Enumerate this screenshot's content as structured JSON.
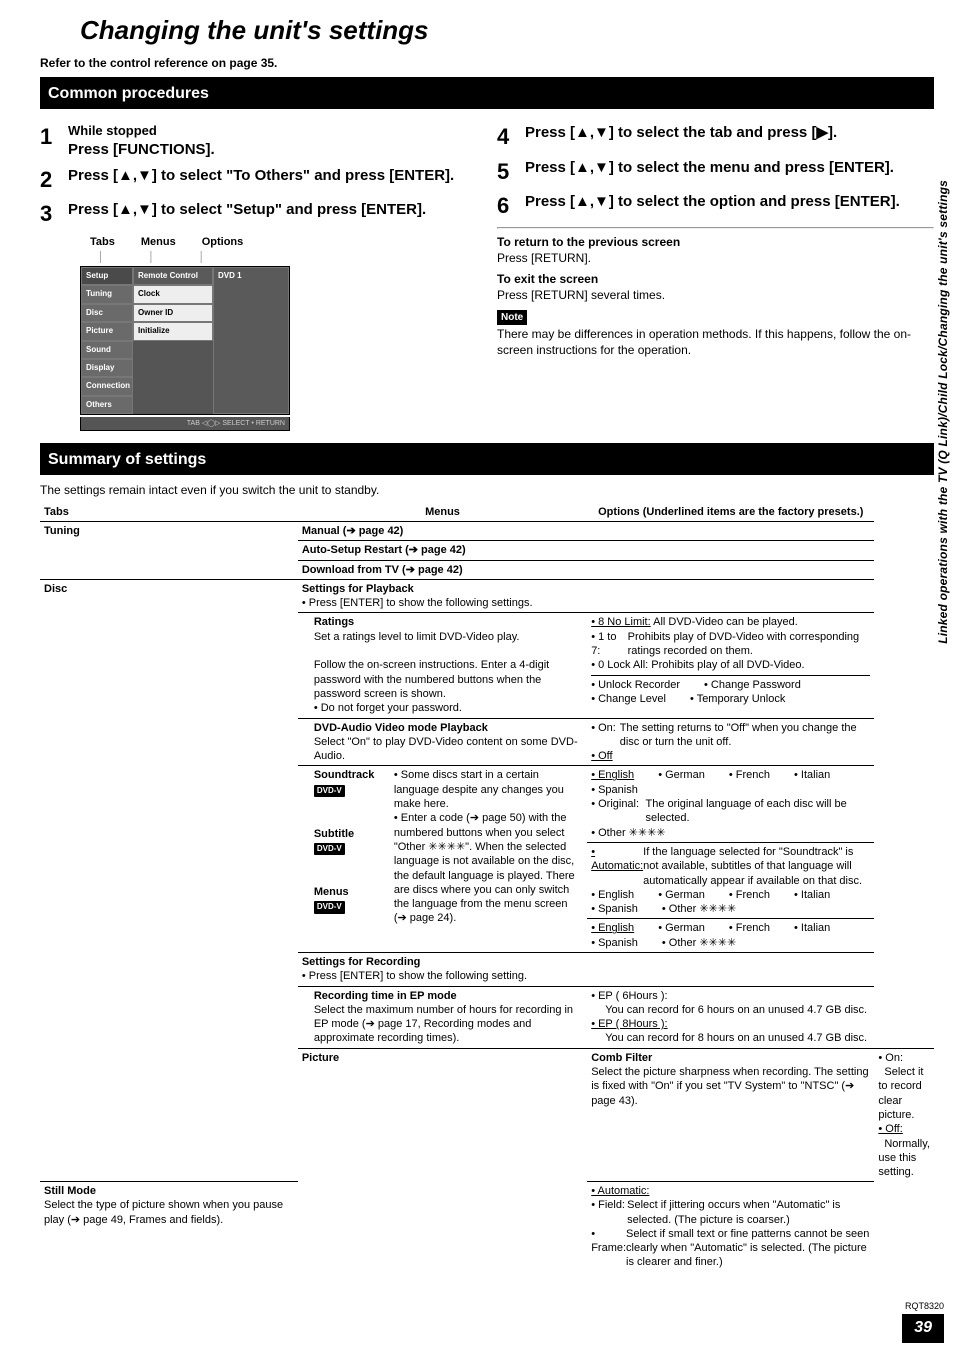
{
  "title": "Changing the unit's settings",
  "ref_line": "Refer to the control reference on page 35.",
  "sections": {
    "common": "Common procedures",
    "summary": "Summary of settings"
  },
  "steps": [
    {
      "num": "1",
      "pre": "While stopped",
      "act": "Press [FUNCTIONS]."
    },
    {
      "num": "2",
      "pre": "",
      "act": "Press [▲,▼] to select \"To Others\" and press [ENTER]."
    },
    {
      "num": "3",
      "pre": "",
      "act": "Press [▲,▼] to select \"Setup\" and press [ENTER]."
    },
    {
      "num": "4",
      "pre": "",
      "act": "Press [▲,▼] to select the tab and press [▶]."
    },
    {
      "num": "5",
      "pre": "",
      "act": "Press [▲,▼] to select the menu and press [ENTER]."
    },
    {
      "num": "6",
      "pre": "",
      "act": "Press [▲,▼] to select the option and press [ENTER]."
    }
  ],
  "diagram": {
    "labels": [
      "Tabs",
      "Menus",
      "Options"
    ],
    "tabs": [
      "Setup",
      "Tuning",
      "Disc",
      "Picture",
      "Sound",
      "Display",
      "Connection",
      "Others"
    ],
    "menus": [
      "Remote Control",
      "Clock",
      "Owner ID",
      "Initialize"
    ],
    "option": "DVD 1",
    "footer": "TAB ◁◯▷ SELECT • RETURN"
  },
  "return_block": {
    "h1": "To return to the previous screen",
    "t1": "Press [RETURN].",
    "h2": "To exit the screen",
    "t2": "Press [RETURN] several times.",
    "note_label": "Note",
    "note_text": "There may be differences in operation methods. If this happens, follow the on-screen instructions for the operation."
  },
  "intro_line": "The settings remain intact even if you switch the unit to standby.",
  "table_headers": {
    "tabs": "Tabs",
    "menus": "Menus",
    "options": "Options (Underlined items are the factory presets.)"
  },
  "tuning": {
    "tab": "Tuning",
    "rows": [
      "Manual (➔ page 42)",
      "Auto-Setup Restart (➔ page 42)",
      "Download from TV (➔ page 42)"
    ]
  },
  "disc": {
    "tab": "Disc",
    "playback_header": "Settings for Playback",
    "playback_note": "• Press [ENTER] to show the following settings.",
    "ratings": {
      "title": "Ratings",
      "desc1": "Set a ratings level to limit DVD-Video play.",
      "desc2": "Follow the on-screen instructions. Enter a 4-digit password with the numbered buttons when the password screen is shown.",
      "desc3": "• Do not forget your password.",
      "opt1_label": "• 8 No Limit:",
      "opt1_text": "All DVD-Video can be played.",
      "opt2_label": "• 1 to 7:",
      "opt2_text": "Prohibits play of DVD-Video with corresponding ratings recorded on them.",
      "opt3_label": "• 0 Lock All:",
      "opt3_text": "Prohibits play of all DVD-Video.",
      "sub_opts": [
        "• Unlock Recorder",
        "• Change Password",
        "• Change Level",
        "• Temporary Unlock"
      ]
    },
    "dvdaudio": {
      "title": "DVD-Audio Video mode Playback",
      "desc": "Select \"On\" to play DVD-Video content on some DVD-Audio.",
      "opt_on_label": "• On:",
      "opt_on_text": "The setting returns to \"Off\" when you change the disc or turn the unit off.",
      "opt_off": "• Off"
    },
    "soundtrack": {
      "title": "Soundtrack",
      "tag": "DVD-V",
      "langs": [
        "• English",
        "• German",
        "• French",
        "• Italian",
        "• Spanish"
      ],
      "orig_label": "• Original:",
      "orig_text": "The original language of each disc will be selected.",
      "other": "• Other ✳✳✳✳"
    },
    "shared_desc": {
      "line1": "• Some discs start in a certain language despite any changes you make here.",
      "line2": "• Enter a code (➔ page 50) with the numbered buttons when you select \"Other ✳✳✳✳\". When the selected language is not available on the disc, the default language is played. There are discs where you can only switch the language from the menu screen (➔ page 24)."
    },
    "subtitle": {
      "title": "Subtitle",
      "tag": "DVD-V",
      "auto_label": "• Automatic:",
      "auto_text": "If the language selected for \"Soundtrack\" is not available, subtitles of that language will automatically appear if available on that disc.",
      "langs": [
        "• English",
        "• German",
        "• French",
        "• Italian",
        "• Spanish"
      ],
      "other": "• Other ✳✳✳✳"
    },
    "menus": {
      "title": "Menus",
      "tag": "DVD-V",
      "langs": [
        "• English",
        "• German",
        "• French",
        "• Italian",
        "• Spanish"
      ],
      "other": "• Other ✳✳✳✳"
    },
    "recording_header": "Settings for Recording",
    "recording_note": "• Press [ENTER] to show the following setting.",
    "ep": {
      "title": "Recording time in EP mode",
      "desc": "Select the maximum number of hours for recording in EP mode (➔ page 17, Recording modes and approximate recording times).",
      "opt1_label": "• EP ( 6Hours ):",
      "opt1_text": "You can record for 6 hours on an unused 4.7 GB disc.",
      "opt2_label": "• EP ( 8Hours ):",
      "opt2_text": "You can record for 8 hours on an unused 4.7 GB disc."
    }
  },
  "picture": {
    "tab": "Picture",
    "comb": {
      "title": "Comb Filter",
      "desc": "Select the picture sharpness when recording. The setting is fixed with \"On\" if you set \"TV System\" to \"NTSC\" (➔ page 43).",
      "opt_on_label": "• On:",
      "opt_on_text": "Select it to record clear picture.",
      "opt_off_label": "• Off:",
      "opt_off_text": "Normally, use this setting."
    },
    "still": {
      "title": "Still Mode",
      "desc": "Select the type of picture shown when you pause play (➔ page 49, Frames and fields).",
      "opt_auto": "• Automatic:",
      "opt_field_label": "• Field:",
      "opt_field_text": "Select if jittering occurs when \"Automatic\" is selected. (The picture is coarser.)",
      "opt_frame_label": "• Frame:",
      "opt_frame_text": "Select if small text or fine patterns cannot be seen clearly when \"Automatic\" is selected. (The picture is clearer and finer.)"
    }
  },
  "side_label": "Linked operations with the TV (Q Link)/Child Lock/Changing the unit's settings",
  "footer": {
    "code": "RQT8320",
    "page": "39"
  }
}
